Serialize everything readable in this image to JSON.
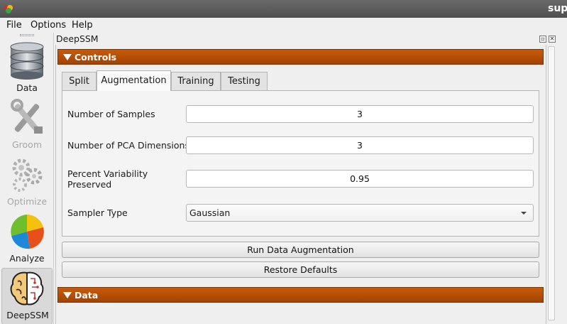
{
  "window": {
    "title": "sup"
  },
  "menu": {
    "items": [
      "File",
      "Options",
      "Help"
    ]
  },
  "toolbar": {
    "modules": [
      {
        "label": "Data",
        "icon": "database-icon",
        "enabled": true
      },
      {
        "label": "Groom",
        "icon": "tools-icon",
        "enabled": false
      },
      {
        "label": "Optimize",
        "icon": "gears-icon",
        "enabled": false
      },
      {
        "label": "Analyze",
        "icon": "pie-chart-icon",
        "enabled": true
      },
      {
        "label": "DeepSSM",
        "icon": "brain-icon",
        "enabled": true,
        "active": true
      }
    ]
  },
  "dock": {
    "title": "DeepSSM",
    "controls_header": "Controls",
    "data_header": "Data",
    "tabs": [
      "Split",
      "Augmentation",
      "Training",
      "Testing"
    ],
    "selected_tab": "Augmentation",
    "fields": {
      "num_samples": {
        "label": "Number of Samples",
        "value": "3"
      },
      "num_pca": {
        "label": "Number of PCA Dimensions",
        "value": "3"
      },
      "percent_variability": {
        "label": "Percent Variability\nPreserved",
        "value": "0.95"
      },
      "sampler_type": {
        "label": "Sampler Type",
        "value": "Gaussian"
      }
    },
    "buttons": {
      "run": "Run Data Augmentation",
      "restore": "Restore Defaults"
    }
  },
  "colors": {
    "section_header": "#b24d06",
    "title_bar": "#5c5c5c"
  }
}
